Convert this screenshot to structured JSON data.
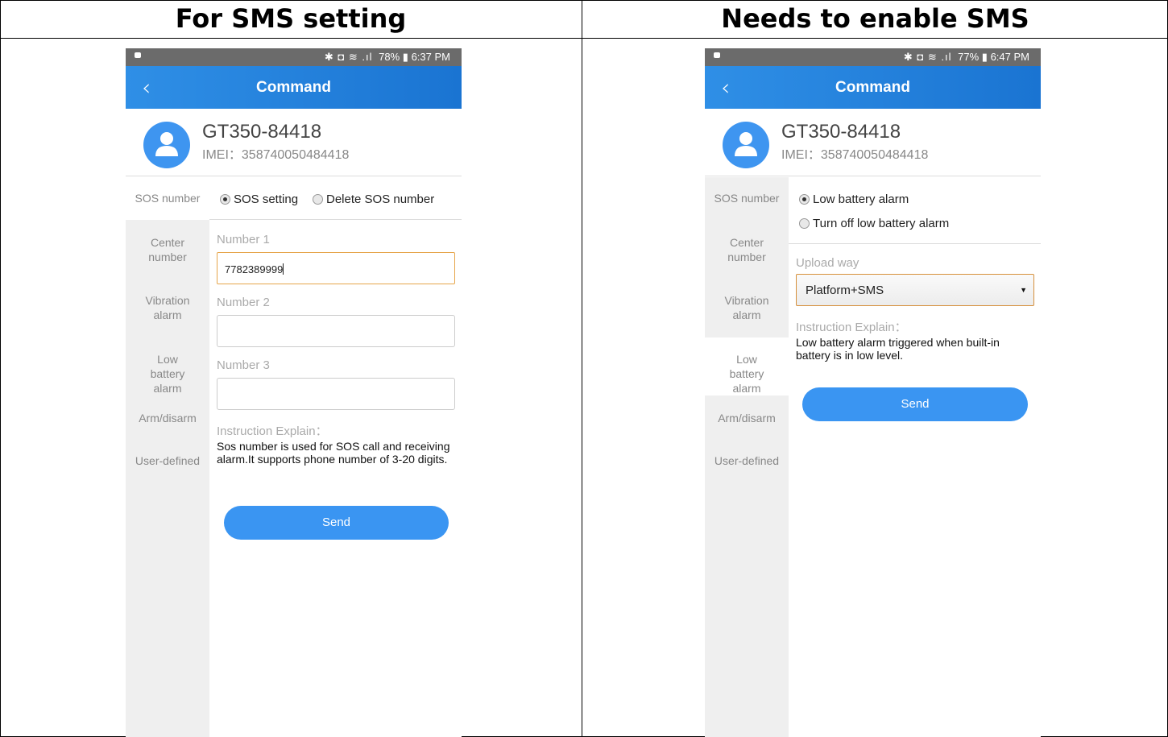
{
  "panels": [
    {
      "heading": "For SMS setting",
      "status": {
        "icons": "✱ ◘ ≋ .ıl",
        "battery": "78%",
        "time": "6:37 PM"
      },
      "appbar": {
        "back_icon": "‹",
        "title": "Command"
      },
      "device": {
        "name": "GT350-84418",
        "imei": "IMEI：358740050484418"
      },
      "sidebar": [
        "SOS number",
        "Center number",
        "Vibration alarm",
        "Low battery alarm",
        "Arm/disarm",
        "User-defined"
      ],
      "radios": [
        {
          "label": "SOS setting",
          "selected": true
        },
        {
          "label": "Delete SOS number",
          "selected": false
        }
      ],
      "numbers": [
        {
          "label": "Number 1",
          "value": "7782389999"
        },
        {
          "label": "Number 2",
          "value": ""
        },
        {
          "label": "Number 3",
          "value": ""
        }
      ],
      "explain_label": "Instruction Explain：",
      "explain_text": "Sos number is used for SOS call and receiving alarm.It supports phone number of 3-20 digits.",
      "send_label": "Send"
    },
    {
      "heading": "Needs to enable SMS",
      "status": {
        "icons": "✱ ◘ ≋ .ıl",
        "battery": "77%",
        "time": "6:47 PM"
      },
      "appbar": {
        "back_icon": "‹",
        "title": "Command"
      },
      "device": {
        "name": "GT350-84418",
        "imei": "IMEI：358740050484418"
      },
      "sidebar": [
        "SOS number",
        "Center number",
        "Vibration alarm",
        "Low battery alarm",
        "Arm/disarm",
        "User-defined"
      ],
      "radios": [
        {
          "label": "Low battery alarm",
          "selected": true
        },
        {
          "label": "Turn off low battery alarm",
          "selected": false
        }
      ],
      "upload_label": "Upload way",
      "upload_value": "Platform+SMS",
      "explain_label": "Instruction Explain：",
      "explain_text": "Low battery alarm triggered when built-in battery is in low level.",
      "send_label": "Send"
    }
  ],
  "colors": {
    "appbar": "#1a74d2",
    "send_button": "#3a95f2",
    "focus_border": "#e6a54a",
    "sidebar_bg": "#efefef"
  }
}
